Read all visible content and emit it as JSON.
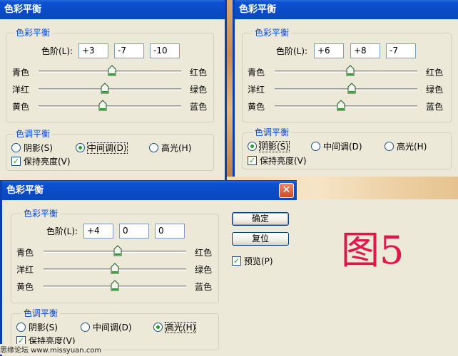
{
  "dialogs": [
    {
      "title": "色彩平衡",
      "color_balance_group": "色彩平衡",
      "levels_label": "色阶(L):",
      "levels": [
        "+3",
        "-7",
        "-10"
      ],
      "sliders": [
        {
          "left": "青色",
          "right": "红色",
          "value": 3
        },
        {
          "left": "洋红",
          "right": "绿色",
          "value": -7
        },
        {
          "left": "黄色",
          "right": "蓝色",
          "value": -10
        }
      ],
      "tone_group": "色调平衡",
      "tones": [
        "阴影(S)",
        "中间调(D)",
        "高光(H)"
      ],
      "tone_selected": 1,
      "preserve_label": "保持亮度(V)",
      "preserve_checked": true
    },
    {
      "title": "色彩平衡",
      "color_balance_group": "色彩平衡",
      "levels_label": "色阶(L):",
      "levels": [
        "+6",
        "+8",
        "-7"
      ],
      "sliders": [
        {
          "left": "青色",
          "right": "红色",
          "value": 6
        },
        {
          "left": "洋红",
          "right": "绿色",
          "value": 8
        },
        {
          "left": "黄色",
          "right": "蓝色",
          "value": -7
        }
      ],
      "tone_group": "色调平衡",
      "tones": [
        "阴影(S)",
        "中间调(D)",
        "高光(H)"
      ],
      "tone_selected": 0,
      "preserve_label": "保持亮度(V)",
      "preserve_checked": true
    },
    {
      "title": "色彩平衡",
      "color_balance_group": "色彩平衡",
      "levels_label": "色阶(L):",
      "levels": [
        "+4",
        "0",
        "0"
      ],
      "sliders": [
        {
          "left": "青色",
          "right": "红色",
          "value": 4
        },
        {
          "left": "洋红",
          "right": "绿色",
          "value": 0
        },
        {
          "left": "黄色",
          "right": "蓝色",
          "value": 0
        }
      ],
      "tone_group": "色调平衡",
      "tones": [
        "阴影(S)",
        "中间调(D)",
        "高光(H)"
      ],
      "tone_selected": 2,
      "preserve_label": "保持亮度(V)",
      "preserve_checked": true,
      "buttons": {
        "ok": "确定",
        "reset": "复位"
      },
      "preview_label": "预览(P)",
      "preview_checked": true,
      "close_icon": "close-icon"
    }
  ],
  "figure_label": "图5",
  "watermark": "思缘论坛 www.missyuan.com",
  "colors": {
    "title_bar": "#0A4BC6",
    "group_label": "#0046D5",
    "figure_label": "#E2164B",
    "dialog_bg": "#ECE9D8"
  }
}
